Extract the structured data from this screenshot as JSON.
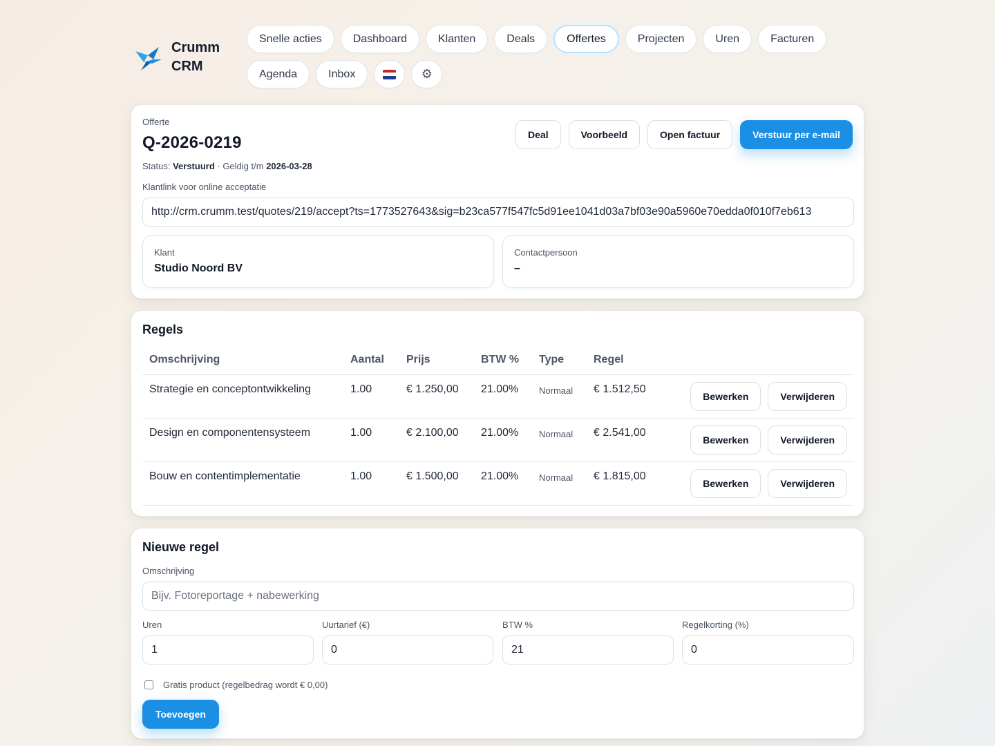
{
  "brand": {
    "name": "Crumm CRM",
    "logo_icon": "bird-logo-icon",
    "accent": "#1a8fe3"
  },
  "nav": {
    "items": [
      {
        "label": "Snelle acties",
        "active": false
      },
      {
        "label": "Dashboard",
        "active": false
      },
      {
        "label": "Klanten",
        "active": false
      },
      {
        "label": "Deals",
        "active": false
      },
      {
        "label": "Offertes",
        "active": true
      },
      {
        "label": "Projecten",
        "active": false
      },
      {
        "label": "Uren",
        "active": false
      },
      {
        "label": "Facturen",
        "active": false
      },
      {
        "label": "Agenda",
        "active": false
      },
      {
        "label": "Inbox",
        "active": false
      }
    ],
    "language_icon": "netherlands-flag-icon",
    "settings_icon": "⚙"
  },
  "quote": {
    "label": "Offerte",
    "number": "Q-2026-0219",
    "status_prefix": "Status: ",
    "status": "Verstuurd",
    "valid_prefix": " · Geldig t/m ",
    "valid_until": "2026-03-28",
    "actions": {
      "deal": "Deal",
      "preview": "Voorbeeld",
      "open_invoice": "Open factuur",
      "send_email": "Verstuur per e-mail"
    },
    "link_label": "Klantlink voor online acceptatie",
    "link_value": "http://crm.crumm.test/quotes/219/accept?ts=1773527643&sig=b23ca577f547fc5d91ee1041d03a7bf03e90a5960e70edda0f010f7eb613",
    "client_label": "Klant",
    "client_value": "Studio Noord BV",
    "contact_label": "Contactpersoon",
    "contact_value": "–"
  },
  "lines": {
    "title": "Regels",
    "columns": [
      "Omschrijving",
      "Aantal",
      "Prijs",
      "BTW %",
      "Type",
      "Regel"
    ],
    "edit_label": "Bewerken",
    "delete_label": "Verwijderen",
    "rows": [
      {
        "description": "Strategie en conceptontwikkeling",
        "qty": "1.00",
        "price": "€ 1.250,00",
        "vat": "21.00%",
        "type": "Normaal",
        "total": "€ 1.512,50"
      },
      {
        "description": "Design en componentensysteem",
        "qty": "1.00",
        "price": "€ 2.100,00",
        "vat": "21.00%",
        "type": "Normaal",
        "total": "€ 2.541,00"
      },
      {
        "description": "Bouw en contentimplementatie",
        "qty": "1.00",
        "price": "€ 1.500,00",
        "vat": "21.00%",
        "type": "Normaal",
        "total": "€ 1.815,00"
      }
    ]
  },
  "new_line": {
    "title": "Nieuwe regel",
    "description_label": "Omschrijving",
    "description_placeholder": "Bijv. Fotoreportage + nabewerking",
    "hours_label": "Uren",
    "hours_value": "1",
    "rate_label": "Uurtarief (€)",
    "rate_value": "0",
    "vat_label": "BTW %",
    "vat_value": "21",
    "discount_label": "Regelkorting (%)",
    "discount_value": "0",
    "free_label": "Gratis product (regelbedrag wordt € 0,00)",
    "free_checked": false,
    "submit_label": "Toevoegen"
  }
}
